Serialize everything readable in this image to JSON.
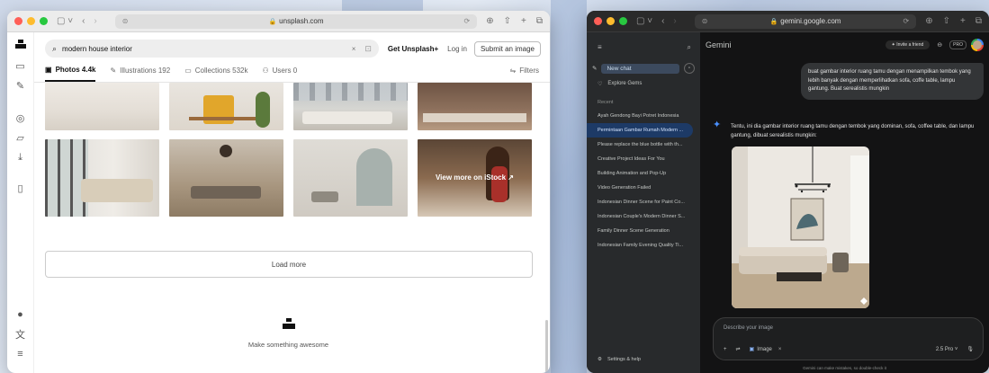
{
  "unsplash": {
    "browser": {
      "url": "unsplash.com"
    },
    "search": {
      "query": "modern house interior",
      "get_plus": "Get Unsplash+",
      "login": "Log in",
      "submit": "Submit an image"
    },
    "tabs": [
      {
        "label": "Photos 4.4k"
      },
      {
        "label": "Illustrations 192"
      },
      {
        "label": "Collections 532k"
      },
      {
        "label": "Users 0"
      }
    ],
    "filters": "Filters",
    "istock": "View more on iStock ↗",
    "load_more": "Load more",
    "footer": "Make something awesome"
  },
  "gemini": {
    "browser": {
      "url": "gemini.google.com"
    },
    "title": "Gemini",
    "invite": "Invite a friend",
    "pro": "PRO",
    "sidebar": {
      "new_chat": "New chat",
      "explore": "Explore Gems",
      "recent_label": "Recent",
      "items": [
        "Ayah Gendong Bayi Potret Indonesia",
        "Permintaan Gambar Rumah Modern ...",
        "Please replace the blue bottle with th...",
        "Creative Project Ideas For You",
        "Building Animation and Pop-Up",
        "Video Generation Failed",
        "Indonesian Dinner Scene for Paint Co...",
        "Indonesian Couple's Modern Dinner S...",
        "Family Dinner Scene Generation",
        "Indonesian Family Evening Quality Ti..."
      ],
      "settings": "Settings & help"
    },
    "user_message": "buat gambar interior ruang tamu dengan menampilkan tembok yang lebih banyak dengan memperlihatkan sofa, coffe table, lampu gantung. Buat serealistis mungkin",
    "reply": "Tentu, ini dia gambar interior ruang tamu dengan tembok yang dominan, sofa, coffee table, dan lampu gantung, dibuat serealistis mungkin:",
    "input_placeholder": "Describe your image",
    "chip": "Image",
    "model": "2.5 Pro",
    "disclaimer": "Gemini can make mistakes, so double-check it"
  }
}
